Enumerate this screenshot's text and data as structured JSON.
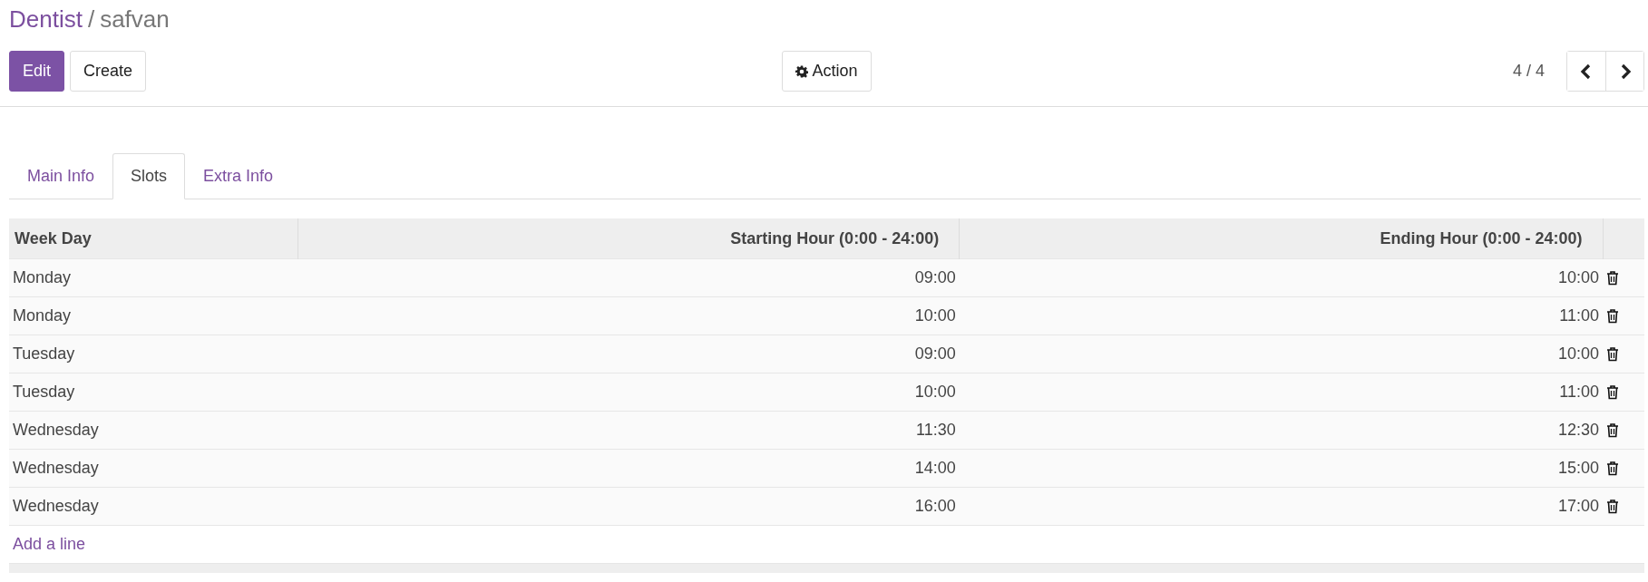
{
  "breadcrumb": {
    "parent": "Dentist",
    "separator": "/",
    "current": "safvan"
  },
  "buttons": [
    {
      "label": "Edit",
      "kind": "primary"
    },
    {
      "label": "Create",
      "kind": "secondary"
    }
  ],
  "action_button": {
    "label": "Action"
  },
  "pager": {
    "value": "4 / 4"
  },
  "tabs": [
    {
      "label": "Main Info",
      "selected": false
    },
    {
      "label": "Slots",
      "selected": true
    },
    {
      "label": "Extra Info",
      "selected": false
    }
  ],
  "table": {
    "columns": [
      "Week Day",
      "Starting Hour (0:00 - 24:00)",
      "Ending Hour (0:00 - 24:00)"
    ],
    "rows": [
      {
        "cells": [
          "Monday",
          "09:00",
          "10:00"
        ]
      },
      {
        "cells": [
          "Monday",
          "10:00",
          "11:00"
        ]
      },
      {
        "cells": [
          "Tuesday",
          "09:00",
          "10:00"
        ]
      },
      {
        "cells": [
          "Tuesday",
          "10:00",
          "11:00"
        ]
      },
      {
        "cells": [
          "Wednesday",
          "11:30",
          "12:30"
        ]
      },
      {
        "cells": [
          "Wednesday",
          "14:00",
          "15:00"
        ]
      },
      {
        "cells": [
          "Wednesday",
          "16:00",
          "17:00"
        ]
      }
    ],
    "add_line": "Add a line"
  }
}
